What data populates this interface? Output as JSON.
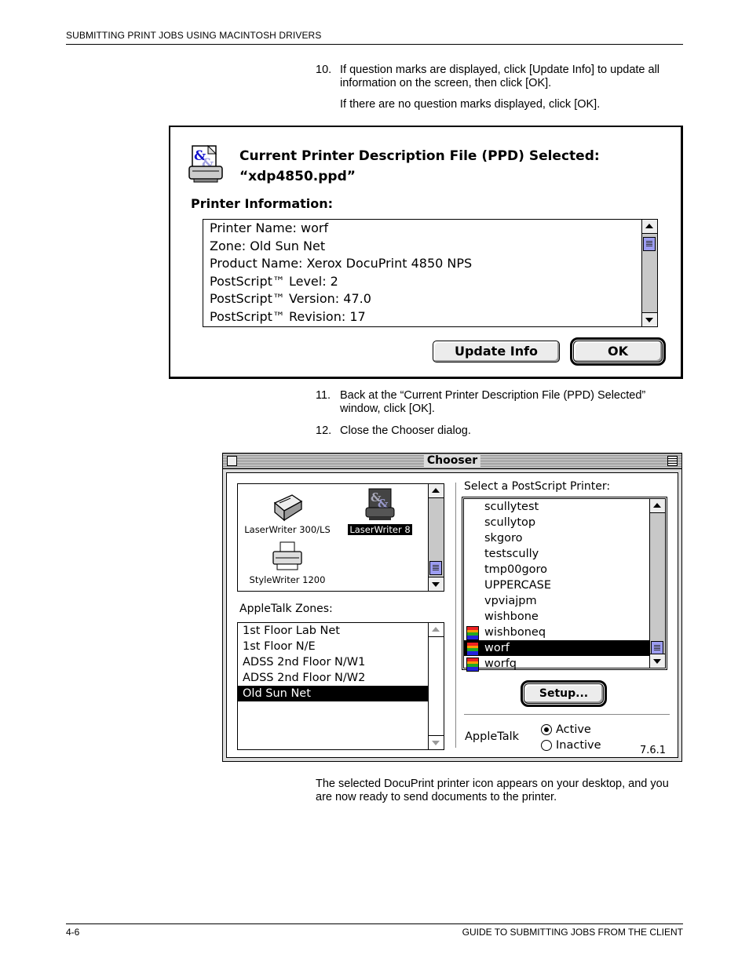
{
  "header": {
    "title": "SUBMITTING PRINT JOBS USING MACINTOSH DRIVERS"
  },
  "steps": [
    {
      "num": "10.",
      "text": "If question marks are displayed, click [Update Info] to update all information on the screen, then click [OK].",
      "note": "If there are no question marks displayed, click [OK]."
    },
    {
      "num": "11.",
      "text": "Back at the “Current Printer Description File (PPD) Selected” window, click [OK]."
    },
    {
      "num": "12.",
      "text": "Close the Chooser dialog."
    }
  ],
  "ppd_dialog": {
    "title_line1": "Current Printer Description File (PPD) Selected:",
    "title_line2": "“xdp4850.ppd”",
    "info_label": "Printer Information:",
    "info_lines": [
      "Printer Name: worf",
      "Zone: Old Sun Net",
      "Product Name: Xerox DocuPrint 4850 NPS",
      "PostScript™ Level: 2",
      "PostScript™ Version: 47.0",
      "PostScript™ Revision: 17"
    ],
    "update_button": "Update Info",
    "ok_button": "OK"
  },
  "chooser": {
    "title": "Chooser",
    "drivers": [
      {
        "label": "LaserWriter 300/LS",
        "selected": false
      },
      {
        "label": "LaserWriter 8",
        "selected": true
      },
      {
        "label": "StyleWriter 1200",
        "selected": false
      }
    ],
    "zones_label": "AppleTalk Zones:",
    "zones": [
      "1st Floor Lab Net",
      "1st Floor N/E",
      "ADSS 2nd Floor N/W1",
      "ADSS 2nd Floor N/W2",
      "Old Sun Net"
    ],
    "selected_zone": "Old Sun Net",
    "printers_label": "Select a PostScript Printer:",
    "printers": [
      {
        "name": "scullytest",
        "icon": false
      },
      {
        "name": "scullytop",
        "icon": false
      },
      {
        "name": "skgoro",
        "icon": false
      },
      {
        "name": "testscully",
        "icon": false
      },
      {
        "name": "tmp00goro",
        "icon": false
      },
      {
        "name": "UPPERCASE",
        "icon": false
      },
      {
        "name": "vpviajpm",
        "icon": false
      },
      {
        "name": "wishbone",
        "icon": false
      },
      {
        "name": "wishboneq",
        "icon": true
      },
      {
        "name": "worf",
        "icon": true,
        "selected": true
      },
      {
        "name": "worfq",
        "icon": true
      }
    ],
    "setup_button": "Setup...",
    "appletalk_label": "AppleTalk",
    "radio_active": "Active",
    "radio_inactive": "Inactive",
    "appletalk_state": "Active",
    "version": "7.6.1"
  },
  "closing_text": "The selected DocuPrint printer icon appears on your desktop, and you are now ready to send documents to the printer.",
  "footer": {
    "page": "4-6",
    "title": "GUIDE TO SUBMITTING JOBS FROM THE CLIENT"
  }
}
